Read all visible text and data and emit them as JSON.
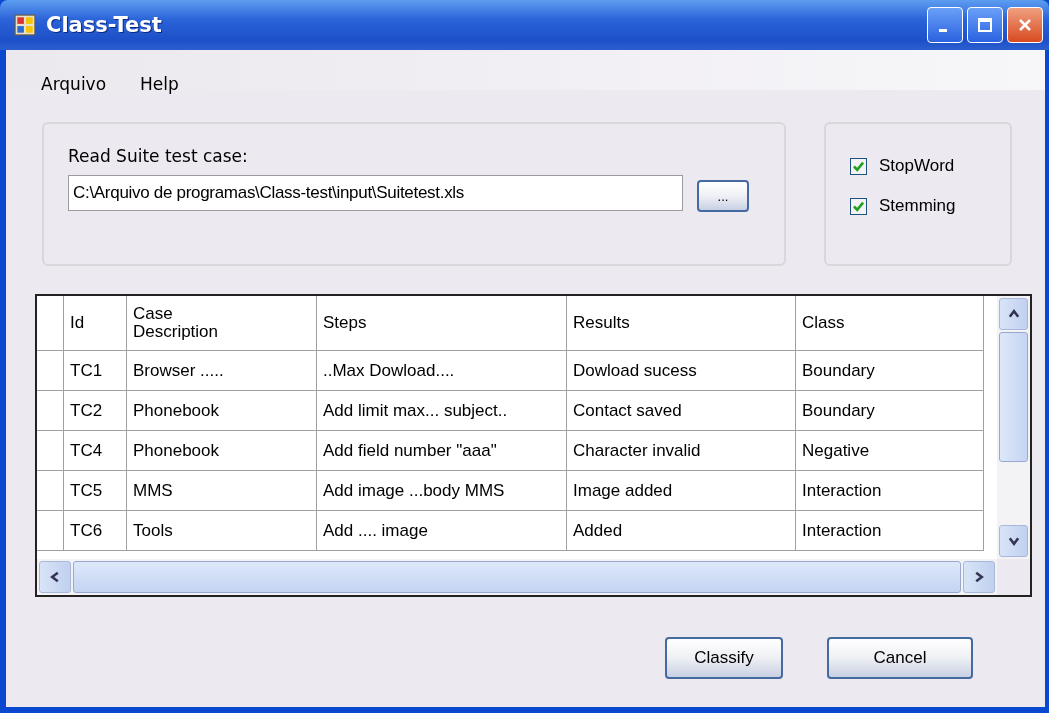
{
  "window": {
    "title": "Class-Test"
  },
  "menu": [
    "Arquivo",
    "Help"
  ],
  "input_group": {
    "label": "Read Suite test case:",
    "value": "C:\\Arquivo de programas\\Class-test\\input\\Suitetest.xls",
    "browse_button": "..."
  },
  "options": [
    {
      "label": "StopWord",
      "checked": true
    },
    {
      "label": "Stemming",
      "checked": true
    }
  ],
  "table": {
    "columns": [
      "Id",
      "Case Description",
      "Steps",
      "Results",
      "Class"
    ],
    "rows": [
      [
        "TC1",
        "Browser .....",
        "..Max Dowload....",
        "Dowload sucess",
        "Boundary"
      ],
      [
        "TC2",
        "Phonebook",
        "Add limit max... subject..",
        "Contact saved",
        "Boundary"
      ],
      [
        "TC4",
        "Phonebook",
        "Add field number \"aaa\"",
        "Character invalid",
        "Negative"
      ],
      [
        "TC5",
        "MMS",
        "Add image ...body MMS",
        "Image added",
        "Interaction"
      ],
      [
        "TC6",
        "Tools",
        "Add .... image",
        "Added",
        "Interaction"
      ]
    ]
  },
  "buttons": [
    "Classify",
    "Cancel"
  ]
}
